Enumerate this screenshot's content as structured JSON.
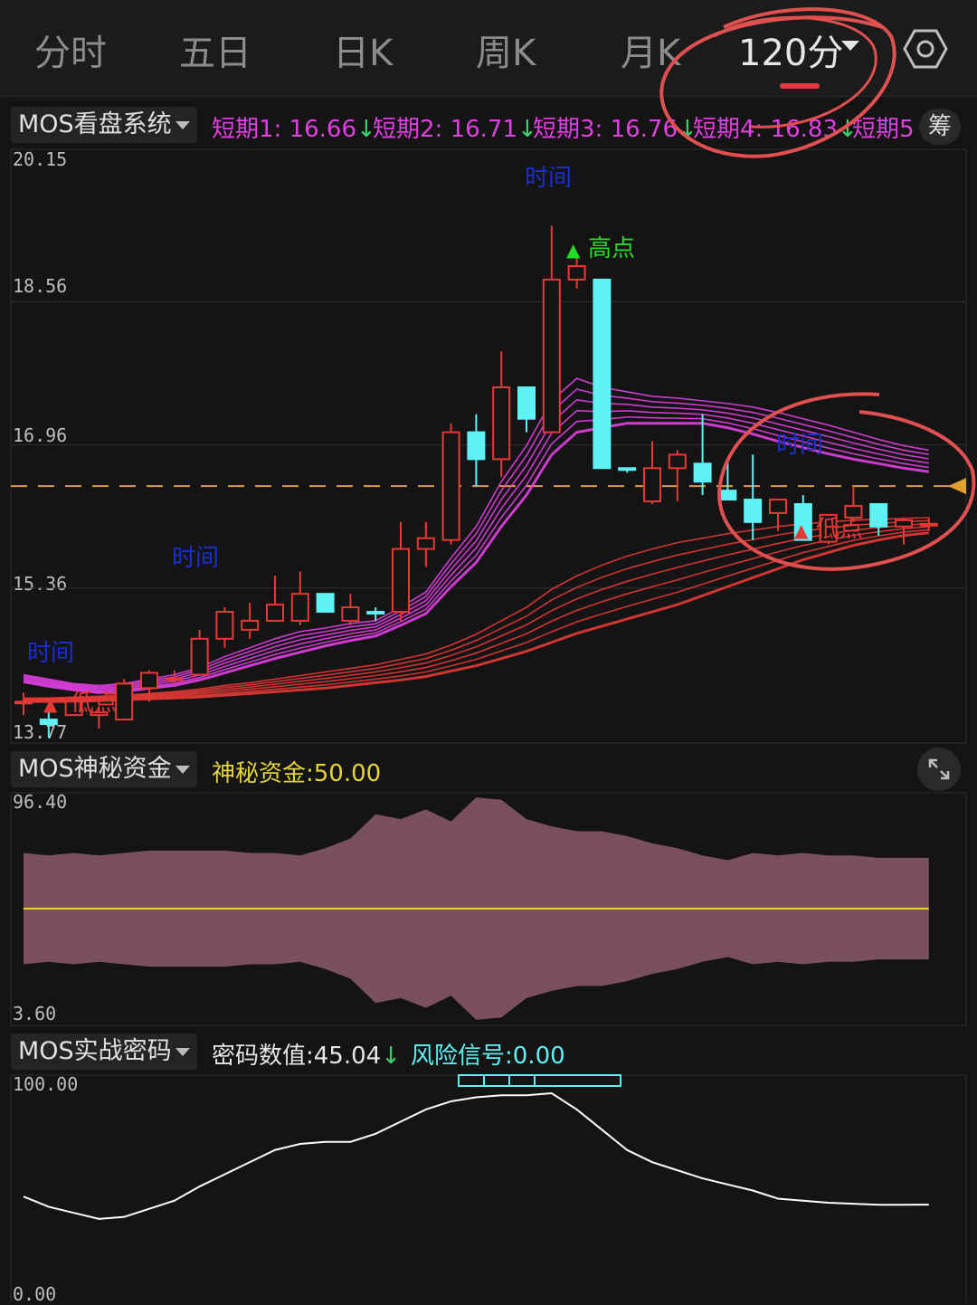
{
  "tabs": [
    {
      "label": "分时",
      "active": false
    },
    {
      "label": "五日",
      "active": false
    },
    {
      "label": "日K",
      "active": false
    },
    {
      "label": "周K",
      "active": false
    },
    {
      "label": "月K",
      "active": false
    },
    {
      "label": "120分",
      "active": true
    }
  ],
  "icons": {
    "settings": "gear-icon",
    "expand": "expand-icon"
  },
  "colors": {
    "up": "#e53935",
    "down": "#5ef2f7",
    "fan_upper": "#e23fe3",
    "fan_lower": "#e53935",
    "ref_line": "#e0a030",
    "money_fill": "#7a5060",
    "money_mid": "#e3d43a",
    "code_line": "#ffffff",
    "risk_box": "#5ef2f7",
    "annotation": "#e05050"
  },
  "panel1": {
    "indicator": "MOS看盘系统",
    "legend": [
      {
        "label": "短期1: 16.66",
        "arrow": "↓"
      },
      {
        "label": "短期2: 16.71",
        "arrow": "↓"
      },
      {
        "label": "短期3: 16.76",
        "arrow": "↓"
      },
      {
        "label": "短期4: 16.83",
        "arrow": "↓"
      },
      {
        "label": "短期5",
        "arrow": ""
      }
    ],
    "chip_button": "筹",
    "yticks": [
      "20.15",
      "18.56",
      "16.96",
      "15.36",
      "13.77"
    ],
    "marks": {
      "time": "时间",
      "high": "高点",
      "low": "低点"
    }
  },
  "panel2": {
    "indicator": "MOS神秘资金",
    "legend_label": "神秘资金:",
    "legend_value": "50.00",
    "ymax": "96.40",
    "ymin": "3.60"
  },
  "panel3": {
    "indicator": "MOS实战密码",
    "code_label": "密码数值:",
    "code_value": "45.04",
    "code_arrow": "↓",
    "risk_label": "风险信号:",
    "risk_value": "0.00",
    "ymax": "100.00",
    "ymin": "0.00"
  },
  "chart_data": [
    {
      "type": "candlestick",
      "title": "MOS看盘系统",
      "ylim": [
        13.77,
        20.15
      ],
      "reference_price": 16.5,
      "candles": [
        {
          "o": 14.1,
          "h": 14.2,
          "l": 13.95,
          "c": 14.1
        },
        {
          "o": 13.9,
          "h": 14.0,
          "l": 13.7,
          "c": 13.85
        },
        {
          "o": 13.95,
          "h": 14.15,
          "l": 13.95,
          "c": 14.1
        },
        {
          "o": 13.95,
          "h": 14.05,
          "l": 13.8,
          "c": 13.98
        },
        {
          "o": 13.9,
          "h": 14.35,
          "l": 13.9,
          "c": 14.3
        },
        {
          "o": 14.25,
          "h": 14.45,
          "l": 14.1,
          "c": 14.42
        },
        {
          "o": 14.35,
          "h": 14.45,
          "l": 14.3,
          "c": 14.36
        },
        {
          "o": 14.4,
          "h": 14.9,
          "l": 14.4,
          "c": 14.8
        },
        {
          "o": 14.8,
          "h": 15.15,
          "l": 14.7,
          "c": 15.1
        },
        {
          "o": 14.9,
          "h": 15.2,
          "l": 14.8,
          "c": 15.0
        },
        {
          "o": 15.0,
          "h": 15.5,
          "l": 15.0,
          "c": 15.18
        },
        {
          "o": 15.0,
          "h": 15.55,
          "l": 14.95,
          "c": 15.3
        },
        {
          "o": 15.3,
          "h": 15.3,
          "l": 15.1,
          "c": 15.1
        },
        {
          "o": 15.0,
          "h": 15.3,
          "l": 14.95,
          "c": 15.15
        },
        {
          "o": 15.1,
          "h": 15.15,
          "l": 15.0,
          "c": 15.08
        },
        {
          "o": 15.1,
          "h": 16.1,
          "l": 15.0,
          "c": 15.8
        },
        {
          "o": 15.8,
          "h": 16.1,
          "l": 15.6,
          "c": 15.92
        },
        {
          "o": 15.9,
          "h": 17.2,
          "l": 15.85,
          "c": 17.1
        },
        {
          "o": 17.1,
          "h": 17.3,
          "l": 16.5,
          "c": 16.8
        },
        {
          "o": 16.8,
          "h": 18.0,
          "l": 16.6,
          "c": 17.6
        },
        {
          "o": 17.6,
          "h": 17.6,
          "l": 17.1,
          "c": 17.25
        },
        {
          "o": 17.1,
          "h": 19.4,
          "l": 17.1,
          "c": 18.8
        },
        {
          "o": 18.8,
          "h": 19.05,
          "l": 18.7,
          "c": 18.95
        },
        {
          "o": 18.8,
          "h": 18.8,
          "l": 16.7,
          "c": 16.7
        },
        {
          "o": 16.7,
          "h": 16.7,
          "l": 16.65,
          "c": 16.68
        },
        {
          "o": 16.33,
          "h": 17.0,
          "l": 16.3,
          "c": 16.7
        },
        {
          "o": 16.7,
          "h": 16.9,
          "l": 16.33,
          "c": 16.85
        },
        {
          "o": 16.75,
          "h": 17.3,
          "l": 16.4,
          "c": 16.55
        },
        {
          "o": 16.45,
          "h": 16.8,
          "l": 16.35,
          "c": 16.35
        },
        {
          "o": 16.35,
          "h": 16.85,
          "l": 15.9,
          "c": 16.1
        },
        {
          "o": 16.2,
          "h": 16.35,
          "l": 16.0,
          "c": 16.35
        },
        {
          "o": 16.3,
          "h": 16.4,
          "l": 15.95,
          "c": 15.9
        },
        {
          "o": 15.88,
          "h": 16.15,
          "l": 15.85,
          "c": 16.18
        },
        {
          "o": 16.15,
          "h": 16.5,
          "l": 16.1,
          "c": 16.28
        },
        {
          "o": 16.3,
          "h": 16.3,
          "l": 15.95,
          "c": 16.05
        },
        {
          "o": 16.05,
          "h": 16.15,
          "l": 15.85,
          "c": 16.12
        },
        {
          "o": 16.08,
          "h": 16.15,
          "l": 16.0,
          "c": 16.08
        }
      ],
      "fan_upper_top": [
        14.4,
        14.35,
        14.3,
        14.28,
        14.3,
        14.35,
        14.4,
        14.48,
        14.6,
        14.7,
        14.8,
        14.88,
        14.92,
        14.97,
        15.0,
        15.15,
        15.32,
        15.7,
        16.05,
        16.55,
        16.95,
        17.45,
        17.7,
        17.6,
        17.55,
        17.5,
        17.48,
        17.45,
        17.42,
        17.38,
        17.32,
        17.25,
        17.18,
        17.1,
        17.02,
        16.95,
        16.9
      ],
      "fan_upper_bottom": [
        14.32,
        14.27,
        14.23,
        14.2,
        14.21,
        14.25,
        14.28,
        14.34,
        14.42,
        14.5,
        14.58,
        14.65,
        14.72,
        14.78,
        14.83,
        14.95,
        15.08,
        15.38,
        15.65,
        16.05,
        16.4,
        16.85,
        17.1,
        17.15,
        17.2,
        17.2,
        17.2,
        17.2,
        17.15,
        17.08,
        17.0,
        16.93,
        16.86,
        16.8,
        16.75,
        16.7,
        16.66
      ],
      "fan_lower_top": [
        14.14,
        14.14,
        14.15,
        14.16,
        14.17,
        14.19,
        14.21,
        14.24,
        14.28,
        14.31,
        14.35,
        14.39,
        14.43,
        14.47,
        14.51,
        14.57,
        14.63,
        14.73,
        14.85,
        15.0,
        15.15,
        15.35,
        15.5,
        15.62,
        15.72,
        15.8,
        15.87,
        15.92,
        15.97,
        16.01,
        16.05,
        16.08,
        16.1,
        16.12,
        16.13,
        16.14,
        16.15
      ],
      "fan_lower_bottom": [
        14.1,
        14.1,
        14.1,
        14.11,
        14.12,
        14.13,
        14.14,
        14.15,
        14.17,
        14.19,
        14.21,
        14.23,
        14.25,
        14.28,
        14.31,
        14.34,
        14.38,
        14.44,
        14.5,
        14.58,
        14.66,
        14.76,
        14.86,
        14.94,
        15.02,
        15.1,
        15.18,
        15.28,
        15.38,
        15.48,
        15.58,
        15.68,
        15.76,
        15.84,
        15.9,
        15.95,
        15.98
      ]
    },
    {
      "type": "area",
      "title": "MOS神秘资金",
      "ylim": [
        3.6,
        96.4
      ],
      "mid": 50.0,
      "upper": [
        73,
        72,
        73,
        72,
        73,
        74,
        74,
        74,
        74,
        73,
        73,
        72,
        75,
        79,
        89,
        87,
        91,
        86,
        96,
        95,
        87,
        84,
        82,
        82,
        80,
        77,
        75,
        72,
        70,
        73,
        72,
        73,
        72,
        72,
        71,
        71,
        71
      ],
      "lower": [
        27,
        28,
        27,
        28,
        27,
        26,
        26,
        26,
        26,
        27,
        27,
        28,
        25,
        21,
        11,
        13,
        9,
        14,
        4,
        5,
        13,
        16,
        18,
        18,
        20,
        23,
        25,
        28,
        30,
        27,
        28,
        27,
        28,
        28,
        29,
        29,
        29
      ]
    },
    {
      "type": "line",
      "title": "MOS实战密码",
      "ylim": [
        0,
        100
      ],
      "values": [
        49,
        44,
        41,
        38,
        39,
        43,
        47,
        54,
        60,
        66,
        72,
        75,
        76,
        76,
        80,
        86,
        92,
        96,
        98,
        99,
        99,
        100,
        92,
        82,
        72,
        66,
        62,
        58,
        55,
        52,
        48,
        47,
        46,
        45.5,
        45,
        45,
        45.04
      ],
      "risk_signal": 0.0
    }
  ]
}
